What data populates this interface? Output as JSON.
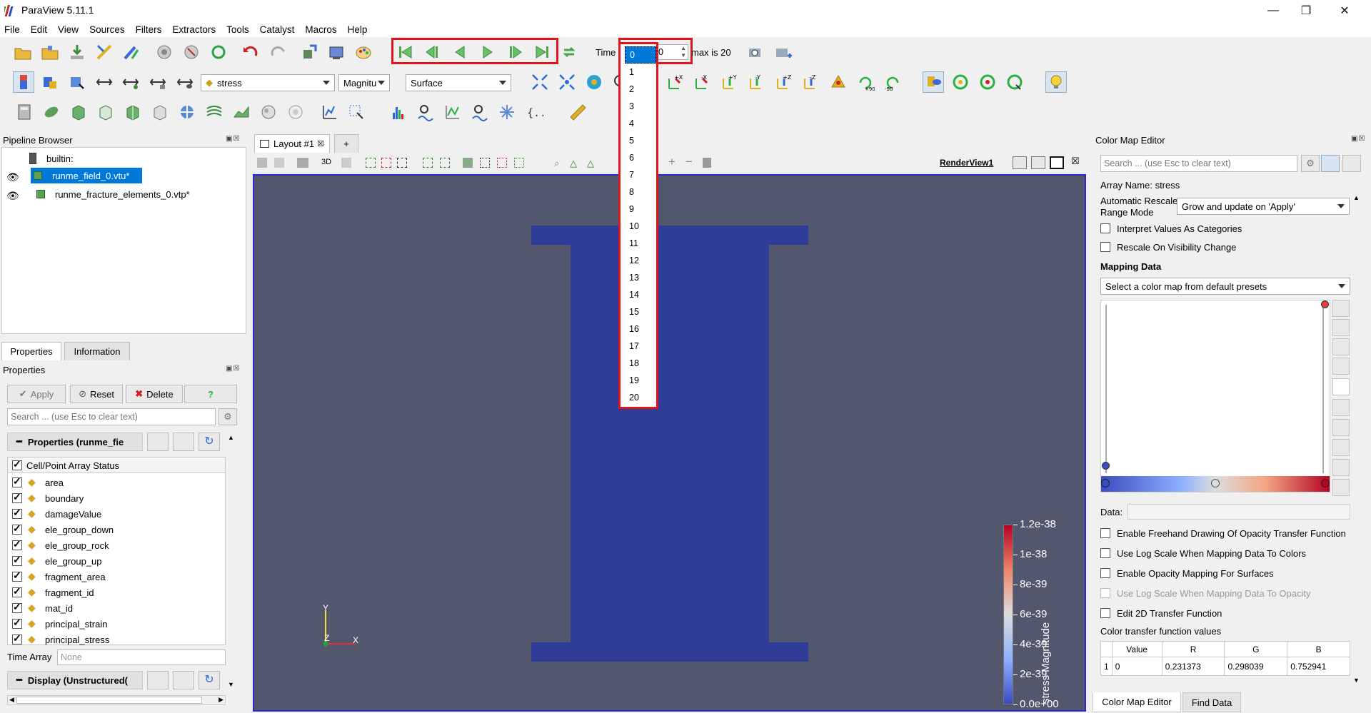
{
  "window": {
    "title": "ParaView 5.11.1",
    "minimize": "—",
    "maximize": "❐",
    "close": "✕"
  },
  "menu": [
    "File",
    "Edit",
    "View",
    "Sources",
    "Filters",
    "Extractors",
    "Tools",
    "Catalyst",
    "Macros",
    "Help"
  ],
  "time_toolbar": {
    "time_label": "Time",
    "time_value": "0",
    "max_label": "max is 20"
  },
  "variable_toolbar": {
    "array": "stress",
    "component": "Magnitu",
    "representation": "Surface"
  },
  "camera_labels": [
    "+X",
    "-X",
    "+Y",
    "-Y",
    "+Z",
    "-Z",
    "+90",
    "-90"
  ],
  "pipeline": {
    "title": "Pipeline Browser",
    "items": [
      "builtin:",
      "runme_field_0.vtu*",
      "runme_fracture_elements_0.vtp*"
    ]
  },
  "properties_panel": {
    "tabs": [
      "Properties",
      "Information"
    ],
    "title": "Properties",
    "apply": "Apply",
    "reset": "Reset",
    "delete": "Delete",
    "help": "?",
    "search_placeholder": "Search ... (use Esc to clear text)",
    "section_props": "Properties (runme_fie",
    "array_status_header": "Cell/Point Array Status",
    "arrays": [
      "area",
      "boundary",
      "damageValue",
      "ele_group_down",
      "ele_group_rock",
      "ele_group_up",
      "fragment_area",
      "fragment_id",
      "mat_id",
      "principal_strain",
      "principal_stress"
    ],
    "time_array_label": "Time Array",
    "time_array_value": "None",
    "section_display": "Display (Unstructured("
  },
  "layout": {
    "tab_label": "Layout #1",
    "add_tab": "+",
    "view_name": "RenderView1",
    "threeD": "3D"
  },
  "time_dropdown": {
    "options": [
      "0",
      "1",
      "2",
      "3",
      "4",
      "5",
      "6",
      "7",
      "8",
      "9",
      "10",
      "11",
      "12",
      "13",
      "14",
      "15",
      "16",
      "17",
      "18",
      "19",
      "20"
    ],
    "selected": "0"
  },
  "scalar_bar": {
    "title": "stress Magnitude",
    "ticks": [
      "1.2e-38",
      "1e-38",
      "8e-39",
      "6e-39",
      "4e-39",
      "2e-39",
      "0.0e+00"
    ]
  },
  "axes": {
    "y": "Y",
    "z": "Z",
    "x": "X"
  },
  "color_map_editor": {
    "title": "Color Map Editor",
    "search_placeholder": "Search ... (use Esc to clear text)",
    "array_name": "Array Name: stress",
    "auto_rescale_label": "Automatic Rescale Range Mode",
    "auto_rescale_value": "Grow and update on 'Apply'",
    "interpret_categories": "Interpret Values As Categories",
    "rescale_visibility": "Rescale On Visibility Change",
    "mapping_data": "Mapping Data",
    "preset_select": "Select a color map from default presets",
    "data_label": "Data:",
    "opt_freehand": "Enable Freehand Drawing Of Opacity Transfer Function",
    "opt_log_colors": "Use Log Scale When Mapping Data To Colors",
    "opt_opacity_surfaces": "Enable Opacity Mapping For Surfaces",
    "opt_log_opacity": "Use Log Scale When Mapping Data To Opacity",
    "opt_2d_tf": "Edit 2D Transfer Function",
    "ctf_values": "Color transfer function values",
    "table_headers": [
      "Value",
      "R",
      "G",
      "B"
    ],
    "table_row": {
      "index": "1",
      "value": "0",
      "r": "0.231373",
      "g": "0.298039",
      "b": "0.752941"
    },
    "bottom_tabs": [
      "Color Map Editor",
      "Find Data"
    ]
  },
  "colors": {
    "render_bg": "#52576e",
    "mesh": "#2f3d98",
    "accent_red": "#e0151b",
    "selection_blue": "#0078d7"
  }
}
